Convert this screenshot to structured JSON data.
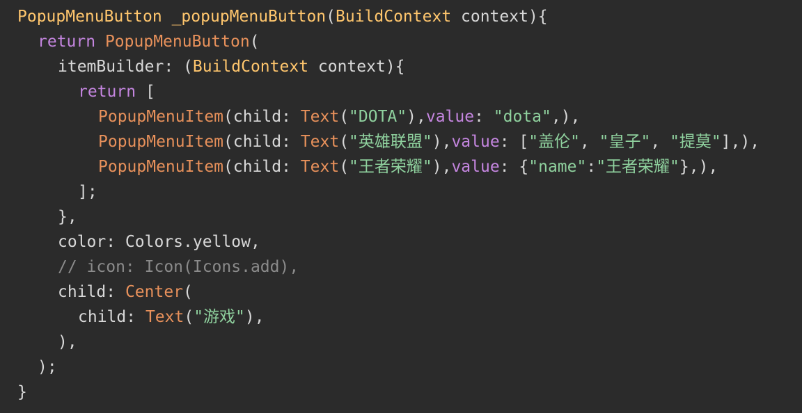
{
  "colors": {
    "background": "#2b2b2b",
    "plain": "#d8d8d8",
    "function_yellow": "#ffc66d",
    "keyword_purple": "#c586e0",
    "class_orange": "#e8915b",
    "string_green": "#8fd19e",
    "comment_gray": "#8b8b8b"
  },
  "code": {
    "l1": {
      "a": "PopupMenuButton",
      "b": " ",
      "c": "_popupMenuButton",
      "d": "(",
      "e": "BuildContext",
      "f": " context){"
    },
    "l2": {
      "a": "return",
      "b": " ",
      "c": "PopupMenuButton",
      "d": "("
    },
    "l3": {
      "a": "itemBuilder: (",
      "b": "BuildContext",
      "c": " context){"
    },
    "l4": {
      "a": "return",
      "b": " ["
    },
    "l5": {
      "a": "PopupMenuItem",
      "b": "(child: ",
      "c": "Text",
      "d": "(",
      "e": "\"DOTA\"",
      "f": "),",
      "g": "value",
      "h": ": ",
      "i": "\"dota\"",
      "j": ",),"
    },
    "l6": {
      "a": "PopupMenuItem",
      "b": "(child: ",
      "c": "Text",
      "d": "(",
      "e": "\"英雄联盟\"",
      "f": "),",
      "g": "value",
      "h": ": [",
      "i": "\"盖伦\"",
      "j": ", ",
      "k": "\"皇子\"",
      "l": ", ",
      "m": "\"提莫\"",
      "n": "],),"
    },
    "l7": {
      "a": "PopupMenuItem",
      "b": "(child: ",
      "c": "Text",
      "d": "(",
      "e": "\"王者荣耀\"",
      "f": "),",
      "g": "value",
      "h": ": {",
      "i": "\"name\"",
      "j": ":",
      "k": "\"王者荣耀\"",
      "l": "},),"
    },
    "l8": {
      "a": "];"
    },
    "l9": {
      "a": "},"
    },
    "l10": {
      "a": "color: Colors.yellow,"
    },
    "l11": {
      "a": "// icon: Icon(Icons.add),"
    },
    "l12": {
      "a": "child: ",
      "b": "Center",
      "c": "("
    },
    "l13": {
      "a": "child: ",
      "b": "Text",
      "c": "(",
      "d": "\"游戏\"",
      "e": "),"
    },
    "l14": {
      "a": "),"
    },
    "l15": {
      "a": ");"
    },
    "l16": {
      "a": "}"
    }
  }
}
